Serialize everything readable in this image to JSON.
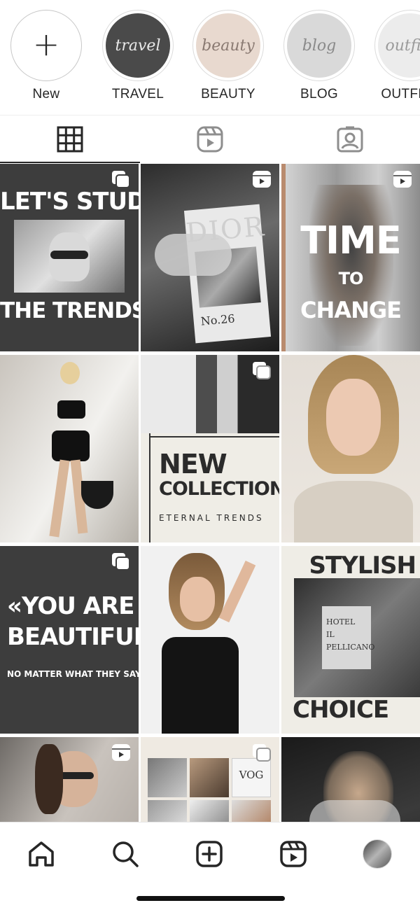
{
  "highlights": [
    {
      "label": "New",
      "icon": "plus-icon"
    },
    {
      "label": "TRAVEL",
      "cover_text": "travel",
      "cover_color": "#4a4a4a",
      "cover_text_color": "#e8e8e8"
    },
    {
      "label": "BEAUTY",
      "cover_text": "beauty",
      "cover_color": "#e8d9cf",
      "cover_text_color": "#8a7a72"
    },
    {
      "label": "BLOG",
      "cover_text": "blog",
      "cover_color": "#d9d9d9",
      "cover_text_color": "#8a8a8a"
    },
    {
      "label": "OUTFITS",
      "cover_text": "outfits",
      "cover_color": "#ececec",
      "cover_text_color": "#9a9a9a"
    }
  ],
  "tabs": [
    {
      "name": "posts",
      "icon": "grid-icon",
      "active": true
    },
    {
      "name": "reels",
      "icon": "reels-icon"
    },
    {
      "name": "tagged",
      "icon": "tagged-user-icon"
    }
  ],
  "posts": [
    {
      "id": "p1",
      "badge": "carousel",
      "line1": "LET'S STUDY",
      "line2": "THE TRENDS?"
    },
    {
      "id": "p2",
      "badge": "reel",
      "magazine_title": "DIOR",
      "magazine_issue": "No.26"
    },
    {
      "id": "p3",
      "badge": "reel",
      "line1": "TIME",
      "line2": "TO",
      "line3": "CHANGE"
    },
    {
      "id": "p4",
      "badge": "none"
    },
    {
      "id": "p5",
      "badge": "carousel",
      "line1": "NEW",
      "line2": "COLLECTION",
      "line3": "ETERNAL TRENDS"
    },
    {
      "id": "p6",
      "badge": "none"
    },
    {
      "id": "p7",
      "badge": "carousel",
      "line1": "«YOU ARE",
      "line2": "BEAUTIFUL,",
      "line3": "NO MATTER WHAT THEY SAY.»"
    },
    {
      "id": "p8",
      "badge": "none"
    },
    {
      "id": "p9",
      "badge": "none",
      "line1": "STYLISH",
      "line2": "CHOICE",
      "bag_line1": "HOTEL",
      "bag_line2": "IL",
      "bag_line3": "PELLICANO"
    },
    {
      "id": "p10",
      "badge": "reel"
    },
    {
      "id": "p11",
      "badge": "carousel",
      "magazine_title": "VOG"
    },
    {
      "id": "p12",
      "badge": "none"
    }
  ],
  "bottom_nav": [
    {
      "name": "home",
      "icon": "home-icon"
    },
    {
      "name": "search",
      "icon": "search-icon"
    },
    {
      "name": "create",
      "icon": "create-post-icon"
    },
    {
      "name": "reels",
      "icon": "reels-icon"
    },
    {
      "name": "profile",
      "icon": "profile-avatar"
    }
  ],
  "colors": {
    "text": "#262626",
    "border": "#dbdbdb",
    "dark_tile": "#3d3d3d",
    "cream_tile": "#efede6"
  }
}
